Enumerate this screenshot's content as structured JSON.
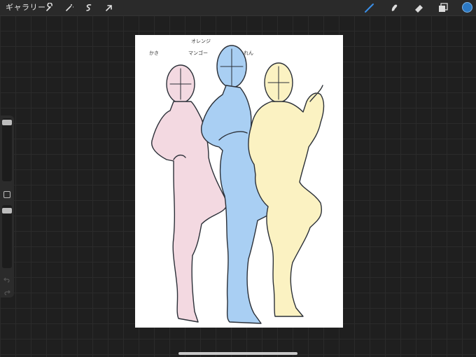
{
  "app": {
    "gallery_label": "ギャラリー"
  },
  "toolbar": {
    "left_tools": [
      "wrench-icon",
      "magic-wand-icon",
      "selection-icon",
      "transform-arrow-icon"
    ],
    "right_tools": [
      "brush-icon",
      "smudge-icon",
      "eraser-icon",
      "layers-icon"
    ],
    "active_tool": "brush-icon",
    "current_color": "#2c79c4",
    "accent_color": "#3a8ee6"
  },
  "sidebar": {
    "brush_size_slider": "top",
    "modify_button": "square-icon",
    "opacity_slider": "bottom",
    "undo_icon": "undo-icon",
    "redo_icon": "redo-icon"
  },
  "canvas": {
    "labels": {
      "orange": "オレンジ",
      "kaki": "かき",
      "mango": "マンゴー",
      "lemon": "れん"
    },
    "figure_colors": {
      "kaki": "#f3d9e1",
      "mango": "#a9cff3",
      "lemon": "#fbf2c2"
    }
  }
}
